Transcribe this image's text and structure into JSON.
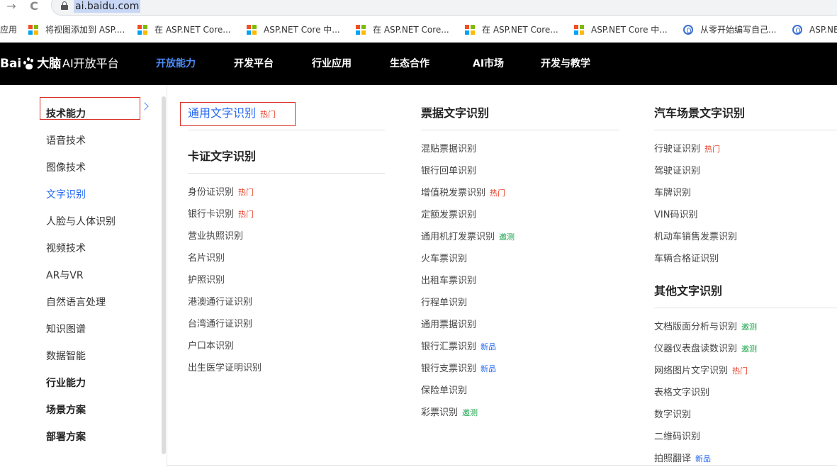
{
  "browser": {
    "url": "ai.baidu.com",
    "back_glyph": "→",
    "reload_glyph": "C"
  },
  "bookmarks": [
    {
      "label": "应用",
      "icon": "apps-icon"
    },
    {
      "label": "将视图添加到 ASP....",
      "icon": "windows-logo-icon"
    },
    {
      "label": "在 ASP.NET Core...",
      "icon": "windows-logo-icon"
    },
    {
      "label": "ASP.NET Core 中...",
      "icon": "windows-logo-icon"
    },
    {
      "label": "在 ASP.NET Core...",
      "icon": "windows-logo-icon"
    },
    {
      "label": "在 ASP.NET Core...",
      "icon": "windows-logo-icon"
    },
    {
      "label": "ASP.NET Core 中...",
      "icon": "windows-logo-icon"
    },
    {
      "label": "从零开始编写自己...",
      "icon": "globe-icon"
    },
    {
      "label": "ASP.NE",
      "icon": "globe-icon"
    }
  ],
  "header": {
    "brand": "Bai",
    "brand_cn": "大脑",
    "brand_sub": "AI开放平台",
    "nav": [
      "开放能力",
      "开发平台",
      "行业应用",
      "生态合作",
      "AI市场",
      "开发与教学"
    ],
    "active_index": 0
  },
  "sidebar": {
    "items": [
      {
        "label": "技术能力",
        "heading": true
      },
      {
        "label": "语音技术"
      },
      {
        "label": "图像技术"
      },
      {
        "label": "文字识别",
        "active": true
      },
      {
        "label": "人脸与人体识别"
      },
      {
        "label": "视频技术"
      },
      {
        "label": "AR与VR"
      },
      {
        "label": "自然语言处理"
      },
      {
        "label": "知识图谱"
      },
      {
        "label": "数据智能"
      },
      {
        "label": "行业能力",
        "heading": true
      },
      {
        "label": "场景方案",
        "heading": true
      },
      {
        "label": "部署方案",
        "heading": true
      }
    ]
  },
  "tags": {
    "hot": "热门",
    "beta": "邀测",
    "new": "新品"
  },
  "columns": {
    "general": {
      "title": "通用文字识别",
      "tag": "hot"
    },
    "card": {
      "title": "卡证文字识别",
      "items": [
        {
          "label": "身份证识别",
          "tag": "hot"
        },
        {
          "label": "银行卡识别",
          "tag": "hot"
        },
        {
          "label": "营业执照识别"
        },
        {
          "label": "名片识别"
        },
        {
          "label": "护照识别"
        },
        {
          "label": "港澳通行证识别"
        },
        {
          "label": "台湾通行证识别"
        },
        {
          "label": "户口本识别"
        },
        {
          "label": "出生医学证明识别"
        }
      ]
    },
    "bill": {
      "title": "票据文字识别",
      "items": [
        {
          "label": "混贴票据识别"
        },
        {
          "label": "银行回单识别"
        },
        {
          "label": "增值税发票识别",
          "tag": "hot"
        },
        {
          "label": "定额发票识别"
        },
        {
          "label": "通用机打发票识别",
          "tag": "beta"
        },
        {
          "label": "火车票识别"
        },
        {
          "label": "出租车票识别"
        },
        {
          "label": "行程单识别"
        },
        {
          "label": "通用票据识别"
        },
        {
          "label": "银行汇票识别",
          "tag": "new"
        },
        {
          "label": "银行支票识别",
          "tag": "new"
        },
        {
          "label": "保险单识别"
        },
        {
          "label": "彩票识别",
          "tag": "beta"
        }
      ]
    },
    "car": {
      "title": "汽车场景文字识别",
      "items": [
        {
          "label": "行驶证识别",
          "tag": "hot"
        },
        {
          "label": "驾驶证识别"
        },
        {
          "label": "车牌识别"
        },
        {
          "label": "VIN码识别"
        },
        {
          "label": "机动车销售发票识别"
        },
        {
          "label": "车辆合格证识别"
        }
      ]
    },
    "other": {
      "title": "其他文字识别",
      "items": [
        {
          "label": "文档版面分析与识别",
          "tag": "beta"
        },
        {
          "label": "仪器仪表盘读数识别",
          "tag": "beta"
        },
        {
          "label": "网络图片文字识别",
          "tag": "hot"
        },
        {
          "label": "表格文字识别"
        },
        {
          "label": "数字识别"
        },
        {
          "label": "二维码识别"
        },
        {
          "label": "拍照翻译",
          "tag": "new"
        }
      ]
    }
  }
}
